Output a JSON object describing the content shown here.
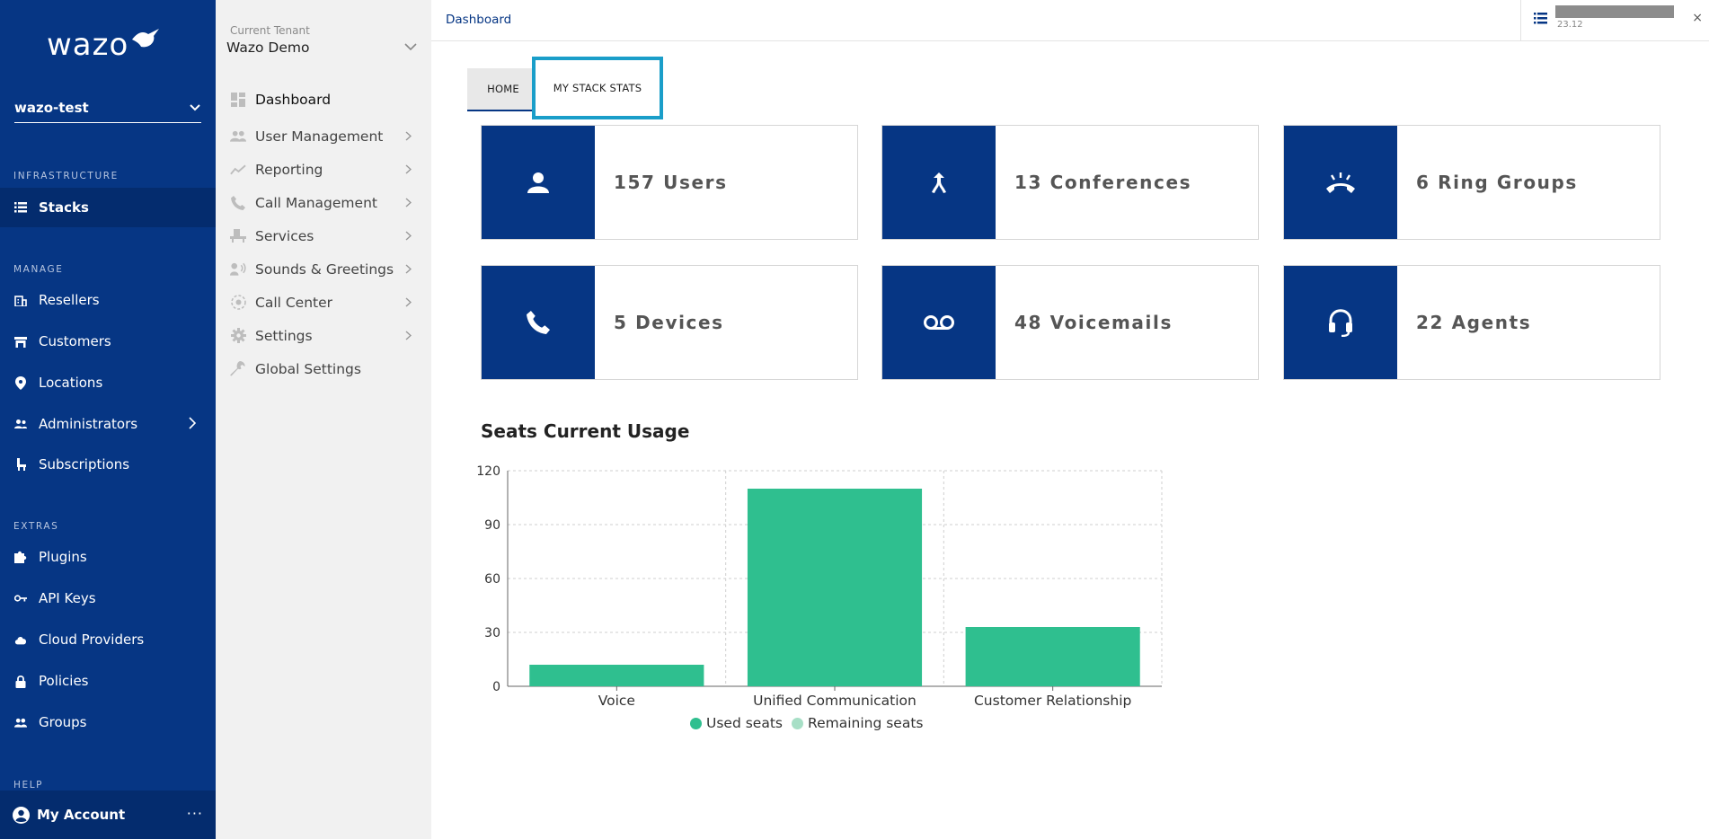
{
  "brand": {
    "logo_text": "wazo"
  },
  "stack_selector": {
    "value": "wazo-test"
  },
  "sidebar": {
    "sections": [
      {
        "label": "INFRASTRUCTURE",
        "items": [
          {
            "label": "Stacks",
            "icon": "stacks-icon",
            "active": true
          }
        ]
      },
      {
        "label": "MANAGE",
        "items": [
          {
            "label": "Resellers",
            "icon": "building-icon"
          },
          {
            "label": "Customers",
            "icon": "store-icon"
          },
          {
            "label": "Locations",
            "icon": "map-pin-icon"
          },
          {
            "label": "Administrators",
            "icon": "admin-users-icon",
            "has_children": true
          },
          {
            "label": "Subscriptions",
            "icon": "seat-icon"
          }
        ]
      },
      {
        "label": "EXTRAS",
        "items": [
          {
            "label": "Plugins",
            "icon": "puzzle-icon"
          },
          {
            "label": "API Keys",
            "icon": "key-icon"
          },
          {
            "label": "Cloud Providers",
            "icon": "cloud-icon"
          },
          {
            "label": "Policies",
            "icon": "lock-icon"
          },
          {
            "label": "Groups",
            "icon": "group-icon"
          }
        ]
      },
      {
        "label": "HELP",
        "items": []
      }
    ],
    "account": {
      "label": "My Account",
      "more": "···"
    }
  },
  "tenant": {
    "label": "Current Tenant",
    "value": "Wazo Demo"
  },
  "subnav": {
    "items": [
      {
        "label": "Dashboard",
        "icon": "dashboard-icon",
        "active": true
      },
      {
        "label": "User Management",
        "icon": "users-icon",
        "has_children": true
      },
      {
        "label": "Reporting",
        "icon": "chart-line-icon",
        "has_children": true
      },
      {
        "label": "Call Management",
        "icon": "phone-icon",
        "has_children": true
      },
      {
        "label": "Services",
        "icon": "services-icon",
        "has_children": true
      },
      {
        "label": "Sounds & Greetings",
        "icon": "sound-icon",
        "has_children": true
      },
      {
        "label": "Call Center",
        "icon": "call-center-icon",
        "has_children": true
      },
      {
        "label": "Settings",
        "icon": "gear-icon",
        "has_children": true
      },
      {
        "label": "Global Settings",
        "icon": "wrench-icon"
      }
    ]
  },
  "topbar": {
    "breadcrumb": "Dashboard",
    "version": "23.12",
    "close": "×"
  },
  "tabs": [
    {
      "label": "HOME",
      "active": true
    },
    {
      "label": "MY STACK STATS",
      "highlighted": true
    }
  ],
  "cards": [
    {
      "label": "157 Users",
      "icon": "user-icon"
    },
    {
      "label": "13 Conferences",
      "icon": "merge-icon"
    },
    {
      "label": "6 Ring Groups",
      "icon": "ringing-phone-icon"
    },
    {
      "label": "5 Devices",
      "icon": "phone-icon"
    },
    {
      "label": "48 Voicemails",
      "icon": "voicemail-icon"
    },
    {
      "label": "22 Agents",
      "icon": "headset-icon"
    }
  ],
  "colors": {
    "navy": "#063684",
    "used": "#2fbf8f",
    "remaining": "#a7dfc6",
    "highlight": "#1a9ec9"
  },
  "chart_data": {
    "type": "bar",
    "title": "Seats Current Usage",
    "categories": [
      "Voice",
      "Unified Communication",
      "Customer Relationship"
    ],
    "series": [
      {
        "name": "Used seats",
        "values": [
          12,
          110,
          33
        ]
      },
      {
        "name": "Remaining seats",
        "values": [
          0,
          0,
          0
        ]
      }
    ],
    "ylim": [
      0,
      120
    ],
    "yticks": [
      0,
      30,
      60,
      90,
      120
    ],
    "grid": true,
    "legend": "bottom-center"
  }
}
